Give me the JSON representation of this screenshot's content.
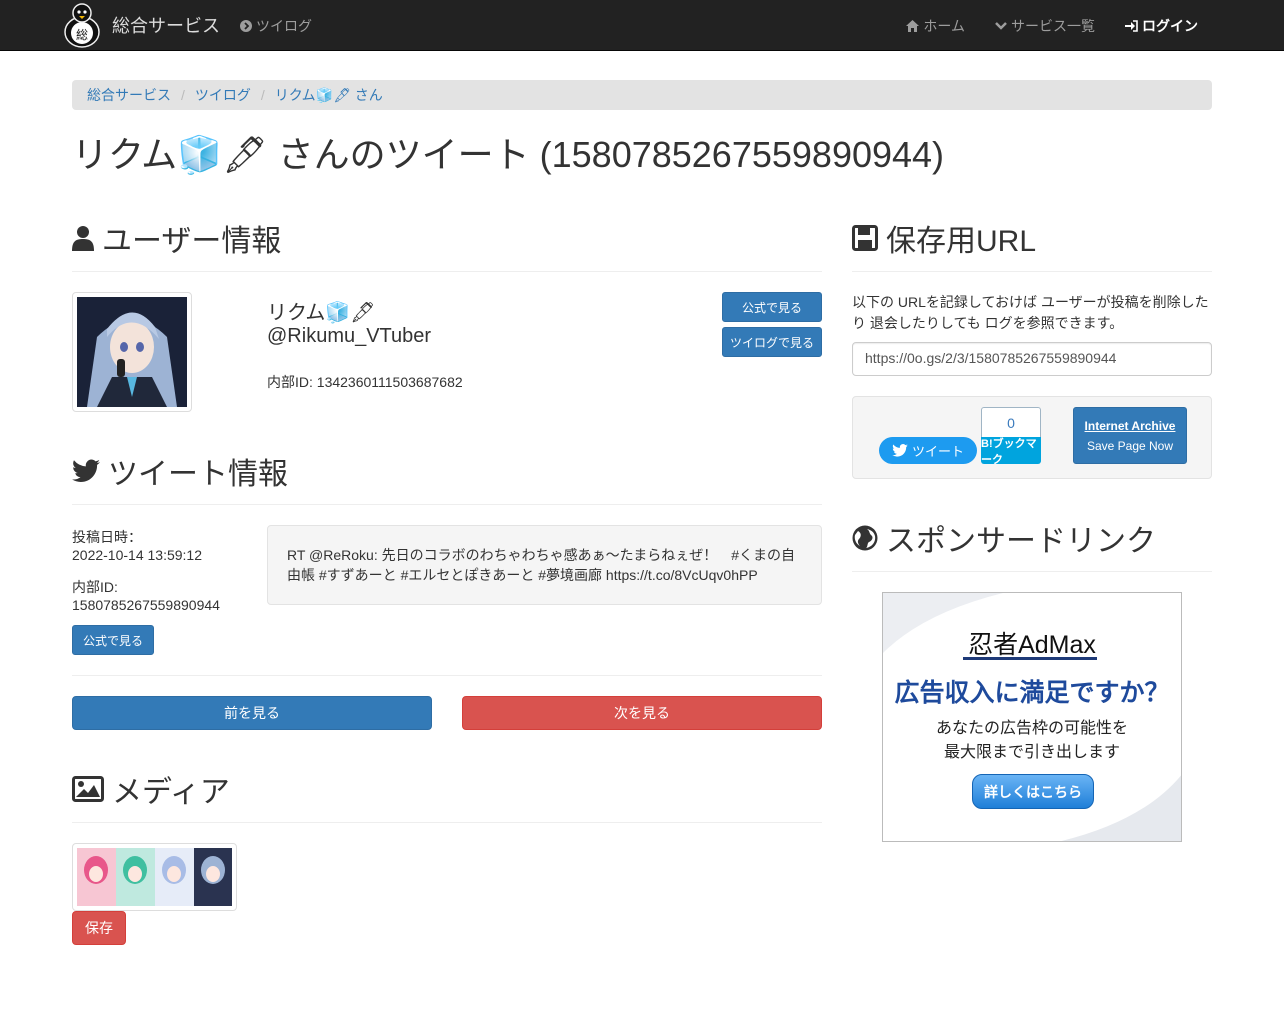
{
  "navbar": {
    "brand": "総合サービス",
    "logo_text": "総",
    "left_link": "ツイログ",
    "right_items": [
      {
        "label": "ホーム",
        "icon": "home-icon"
      },
      {
        "label": "サービス一覧",
        "icon": "chevron-down-icon"
      },
      {
        "label": "ログイン",
        "icon": "sign-in-icon"
      }
    ]
  },
  "breadcrumb": [
    "総合サービス",
    "ツイログ",
    "リクム🧊🖋 さん"
  ],
  "page_title": "リクム🧊🖋 さんのツイート (1580785267559890944)",
  "user_section": {
    "heading": "ユーザー情報",
    "display_name": "リクム🧊🖋",
    "handle": "@Rikumu_VTuber",
    "internal_id": "内部ID: 1342360111503687682",
    "btn_official": "公式で見る",
    "btn_twilog": "ツイログで見る"
  },
  "tweet_section": {
    "heading": "ツイート情報",
    "posted_label": "投稿日時：",
    "posted_at": "2022-10-14 13:59:12",
    "id_label": "内部ID:",
    "id_value": "1580785267559890944",
    "btn_official": "公式で見る",
    "text": "RT @ReRoku: 先日のコラボのわちゃわちゃ感あぁ～たまらねぇぜ！　#くまの自由帳 #すずあーと #エルセとぽきあーと #夢境画廊 https://t.co/8VcUqv0hPP"
  },
  "pager": {
    "prev": "前を見る",
    "next": "次を見る"
  },
  "media_section": {
    "heading": "メディア",
    "save": "保存"
  },
  "save_section": {
    "heading": "保存用URL",
    "desc": "以下の URLを記録しておけば ユーザーが投稿を削除したり 退会したりしても ログを参照できます。",
    "url": "https://0o.gs/2/3/1580785267559890944",
    "tweet_btn": "ツイート",
    "hatena_count": "0",
    "hatena_label": "B!ブックマーク",
    "ia_title": "Internet Archive",
    "ia_sub": "Save Page Now"
  },
  "sponsor_section": {
    "heading": "スポンサードリンク",
    "ad_logo": "忍者AdMax",
    "ad_head": "広告収入に満足ですか？",
    "ad_sub1": "あなたの広告枠の可能性を",
    "ad_sub2": "最大限まで引き出します",
    "ad_cta": "詳しくはこちら"
  },
  "colors": {
    "primary": "#337ab7",
    "danger": "#d9534f",
    "navbar": "#222222",
    "twitter": "#1d9bf0",
    "hatena": "#00a4de"
  }
}
